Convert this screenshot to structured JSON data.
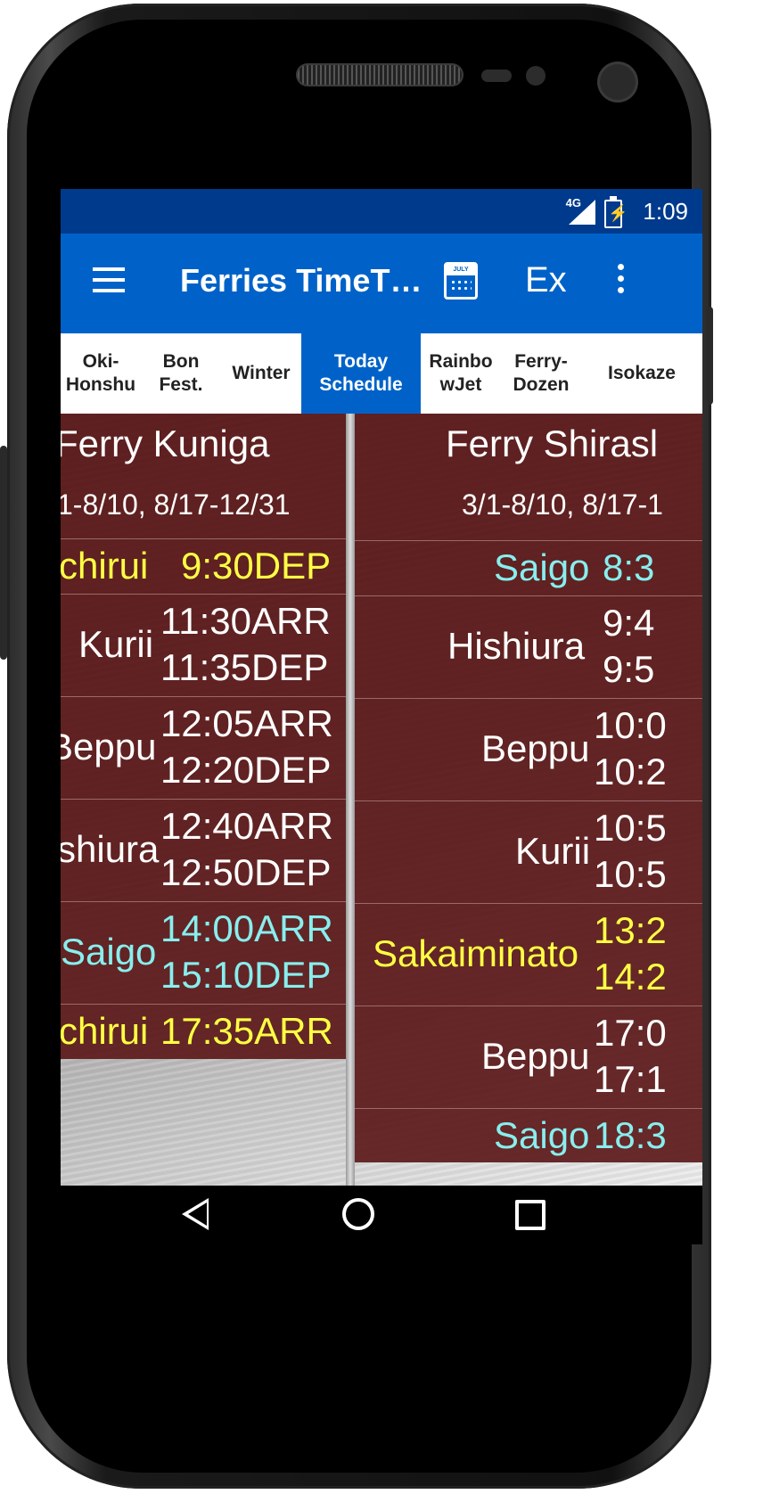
{
  "status": {
    "network": "4G",
    "time": "1:09"
  },
  "appbar": {
    "title": "Ferries TimeT…",
    "ex_label": "Ex",
    "calendar_label": "JULY"
  },
  "tabs": [
    {
      "label": "Oki-\nHonshu",
      "active": false
    },
    {
      "label": "Bon\nFest.",
      "active": false
    },
    {
      "label": "Winter",
      "active": false
    },
    {
      "label": "Today\nSchedule",
      "active": true
    },
    {
      "label": "Rainbo\nwJet",
      "active": false
    },
    {
      "label": "Ferry-\nDozen",
      "active": false
    },
    {
      "label": "Isokaze",
      "active": false
    }
  ],
  "left_col": {
    "name": "Ferry Kuniga",
    "dates": "1-8/10, 8/17-12/31",
    "rows": [
      {
        "place": "chirui",
        "t1": "9:30DEP",
        "t2": "",
        "color": "yellow"
      },
      {
        "place": "Kurii",
        "t1": "11:30ARR",
        "t2": "11:35DEP",
        "color": "white"
      },
      {
        "place": "Beppu",
        "t1": "12:05ARR",
        "t2": "12:20DEP",
        "color": "white"
      },
      {
        "place": "shiura",
        "t1": "12:40ARR",
        "t2": "12:50DEP",
        "color": "white"
      },
      {
        "place": "Saigo",
        "t1": "14:00ARR",
        "t2": "15:10DEP",
        "color": "cyan"
      },
      {
        "place": "chirui",
        "t1": "17:35ARR",
        "t2": "",
        "color": "yellow"
      }
    ]
  },
  "right_col": {
    "name": "Ferry Shirasl",
    "dates": "3/1-8/10, 8/17-1",
    "rows": [
      {
        "place": "Saigo",
        "t1": "8:3",
        "t2": "",
        "color": "cyan"
      },
      {
        "place": "Hishiura",
        "t1": "9:4",
        "t2": "9:5",
        "color": "white"
      },
      {
        "place": "Beppu",
        "t1": "10:0",
        "t2": "10:2",
        "color": "white"
      },
      {
        "place": "Kurii",
        "t1": "10:5",
        "t2": "10:5",
        "color": "white"
      },
      {
        "place": "Sakaiminato",
        "t1": "13:2",
        "t2": "14:2",
        "color": "yellow"
      },
      {
        "place": "Beppu",
        "t1": "17:0",
        "t2": "17:1",
        "color": "white"
      },
      {
        "place": "Saigo",
        "t1": "18:3",
        "t2": "",
        "color": "cyan"
      }
    ]
  }
}
